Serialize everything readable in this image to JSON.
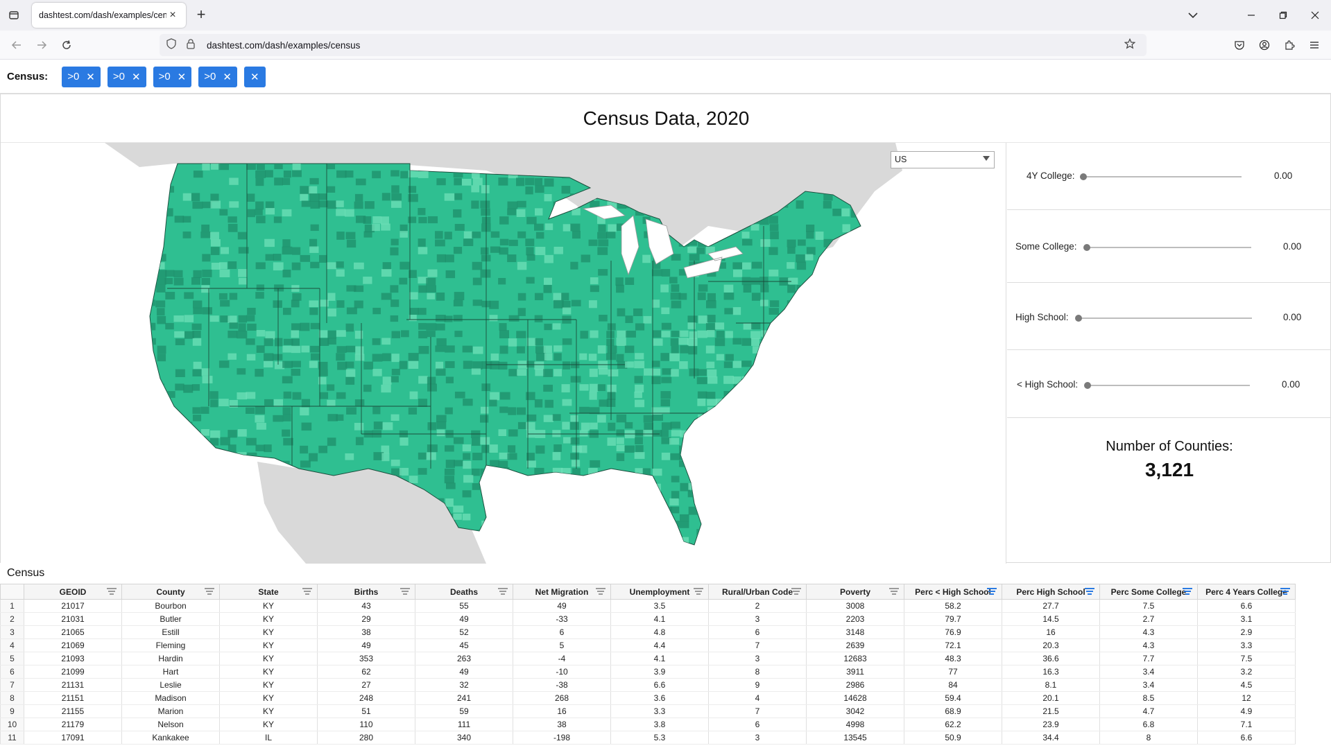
{
  "browser": {
    "tab_title": "dashtest.com/dash/examples/census",
    "url": "dashtest.com/dash/examples/census"
  },
  "filters": {
    "label": "Census:",
    "chips": [
      ">0",
      ">0",
      ">0",
      ">0"
    ]
  },
  "title": "Census Data, 2020",
  "map": {
    "region_select_value": "US",
    "colors": {
      "base": "#2fbf91",
      "dark": "#1f8f6b",
      "light": "#6fe0b8",
      "land": "#d9d9d9",
      "water": "#ffffff",
      "border": "#1b4d3c"
    }
  },
  "sliders": [
    {
      "label": "4Y College:",
      "value": "0.00"
    },
    {
      "label": "Some College:",
      "value": "0.00"
    },
    {
      "label": "High School:",
      "value": "0.00"
    },
    {
      "label": "< High School:",
      "value": "0.00"
    }
  ],
  "counties": {
    "label": "Number of Counties:",
    "value": "3,121"
  },
  "table": {
    "heading": "Census",
    "columns": [
      "GEOID",
      "County",
      "State",
      "Births",
      "Deaths",
      "Net Migration",
      "Unemployment",
      "Rural/Urban Code",
      "Poverty",
      "Perc < High School",
      "Perc High School",
      "Perc Some College",
      "Perc 4 Years College"
    ],
    "active_filter_columns": [
      9,
      10,
      11,
      12
    ],
    "rows": [
      [
        "21017",
        "Bourbon",
        "KY",
        "43",
        "55",
        "49",
        "3.5",
        "2",
        "3008",
        "58.2",
        "27.7",
        "7.5",
        "6.6"
      ],
      [
        "21031",
        "Butler",
        "KY",
        "29",
        "49",
        "-33",
        "4.1",
        "3",
        "2203",
        "79.7",
        "14.5",
        "2.7",
        "3.1"
      ],
      [
        "21065",
        "Estill",
        "KY",
        "38",
        "52",
        "6",
        "4.8",
        "6",
        "3148",
        "76.9",
        "16",
        "4.3",
        "2.9"
      ],
      [
        "21069",
        "Fleming",
        "KY",
        "49",
        "45",
        "5",
        "4.4",
        "7",
        "2639",
        "72.1",
        "20.3",
        "4.3",
        "3.3"
      ],
      [
        "21093",
        "Hardin",
        "KY",
        "353",
        "263",
        "-4",
        "4.1",
        "3",
        "12683",
        "48.3",
        "36.6",
        "7.7",
        "7.5"
      ],
      [
        "21099",
        "Hart",
        "KY",
        "62",
        "49",
        "-10",
        "3.9",
        "8",
        "3911",
        "77",
        "16.3",
        "3.4",
        "3.2"
      ],
      [
        "21131",
        "Leslie",
        "KY",
        "27",
        "32",
        "-38",
        "6.6",
        "9",
        "2986",
        "84",
        "8.1",
        "3.4",
        "4.5"
      ],
      [
        "21151",
        "Madison",
        "KY",
        "248",
        "241",
        "268",
        "3.6",
        "4",
        "14628",
        "59.4",
        "20.1",
        "8.5",
        "12"
      ],
      [
        "21155",
        "Marion",
        "KY",
        "51",
        "59",
        "16",
        "3.3",
        "7",
        "3042",
        "68.9",
        "21.5",
        "4.7",
        "4.9"
      ],
      [
        "21179",
        "Nelson",
        "KY",
        "110",
        "111",
        "38",
        "3.8",
        "6",
        "4998",
        "62.2",
        "23.9",
        "6.8",
        "7.1"
      ],
      [
        "17091",
        "Kankakee",
        "IL",
        "280",
        "340",
        "-198",
        "5.3",
        "3",
        "13545",
        "50.9",
        "34.4",
        "8",
        "6.6"
      ]
    ]
  }
}
